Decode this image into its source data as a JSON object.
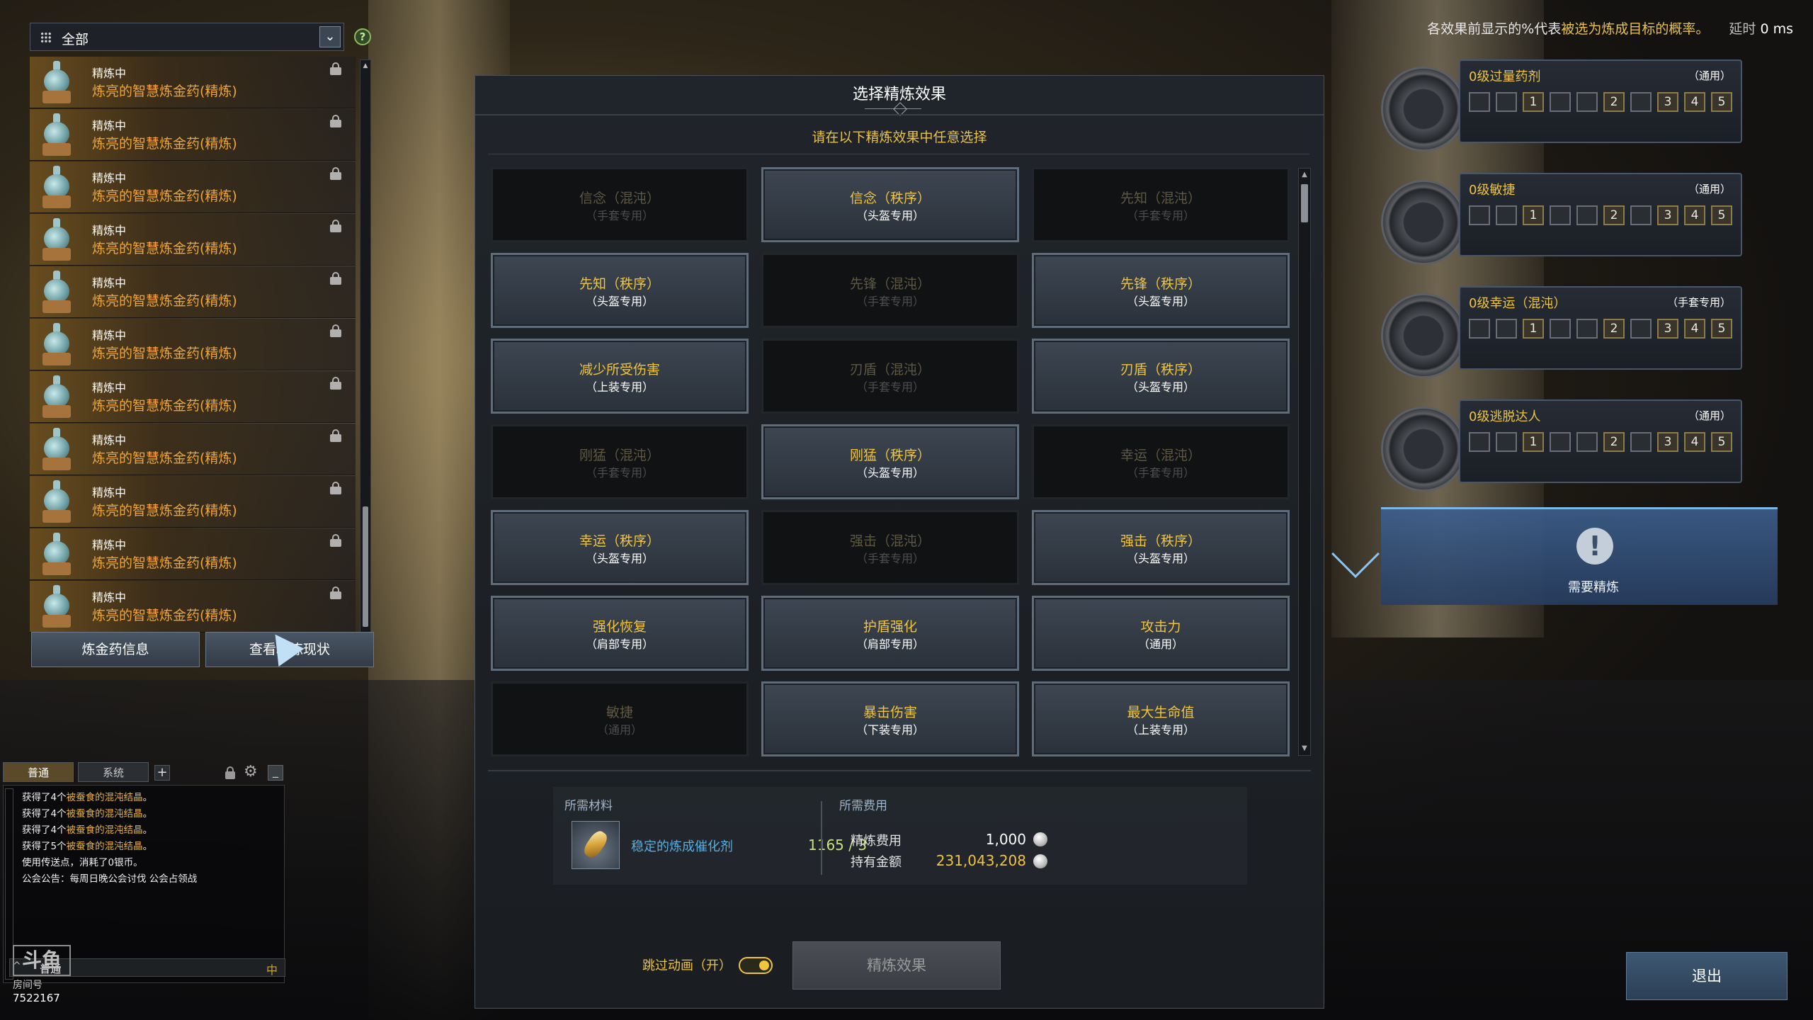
{
  "top_info": {
    "prefix": "各效果前显示的%代表",
    "highlight": "被选为炼成目标的概率。",
    "latency_label": "延时",
    "latency_value": "0 ms"
  },
  "left_panel": {
    "filter_value": "全部",
    "dropdown_icon": "chevron-down-icon",
    "help_label": "?",
    "items": [
      {
        "state": "精炼中",
        "name": "炼亮的智慧炼金药(精炼)"
      },
      {
        "state": "精炼中",
        "name": "炼亮的智慧炼金药(精炼)"
      },
      {
        "state": "精炼中",
        "name": "炼亮的智慧炼金药(精炼)"
      },
      {
        "state": "精炼中",
        "name": "炼亮的智慧炼金药(精炼)"
      },
      {
        "state": "精炼中",
        "name": "炼亮的智慧炼金药(精炼)"
      },
      {
        "state": "精炼中",
        "name": "炼亮的智慧炼金药(精炼)"
      },
      {
        "state": "精炼中",
        "name": "炼亮的智慧炼金药(精炼)"
      },
      {
        "state": "精炼中",
        "name": "炼亮的智慧炼金药(精炼)"
      },
      {
        "state": "精炼中",
        "name": "炼亮的智慧炼金药(精炼)"
      },
      {
        "state": "精炼中",
        "name": "炼亮的智慧炼金药(精炼)"
      },
      {
        "state": "精炼中",
        "name": "炼亮的智慧炼金药(精炼)"
      }
    ],
    "btn_info": "炼金药信息",
    "btn_status": "查看精炼现状"
  },
  "chat": {
    "tab_normal": "普通",
    "tab_system": "系统",
    "plus": "+",
    "lines": [
      {
        "pre": "获得了4个",
        "item": "被蚕食的混沌结晶",
        "post": "。"
      },
      {
        "pre": "获得了4个",
        "item": "被蚕食的混沌结晶",
        "post": "。"
      },
      {
        "pre": "获得了4个",
        "item": "被蚕食的混沌结晶",
        "post": "。"
      },
      {
        "pre": "获得了5个",
        "item": "被蚕食的混沌结晶",
        "post": "。"
      },
      {
        "pre": "使用传送点，消耗了0银币。",
        "item": "",
        "post": ""
      },
      {
        "pre": "公会公告：每周日晚公会讨伐 公会占领战",
        "item": "",
        "post": ""
      }
    ],
    "input_channel": "普通",
    "watermark_logo": "斗鱼",
    "watermark_room": "房间号",
    "watermark_id": "7522167"
  },
  "dialog": {
    "title": "选择精炼效果",
    "subtitle": "请在以下精炼效果中任意选择",
    "effects": [
      {
        "name": "信念（混沌）",
        "sub": "（手套专用）",
        "enabled": false
      },
      {
        "name": "信念（秩序）",
        "sub": "（头盔专用）",
        "enabled": true
      },
      {
        "name": "先知（混沌）",
        "sub": "（手套专用）",
        "enabled": false
      },
      {
        "name": "先知（秩序）",
        "sub": "（头盔专用）",
        "enabled": true
      },
      {
        "name": "先锋（混沌）",
        "sub": "（手套专用）",
        "enabled": false
      },
      {
        "name": "先锋（秩序）",
        "sub": "（头盔专用）",
        "enabled": true
      },
      {
        "name": "减少所受伤害",
        "sub": "（上装专用）",
        "enabled": true
      },
      {
        "name": "刃盾（混沌）",
        "sub": "（手套专用）",
        "enabled": false
      },
      {
        "name": "刃盾（秩序）",
        "sub": "（头盔专用）",
        "enabled": true
      },
      {
        "name": "刚猛（混沌）",
        "sub": "（手套专用）",
        "enabled": false
      },
      {
        "name": "刚猛（秩序）",
        "sub": "（头盔专用）",
        "enabled": true
      },
      {
        "name": "幸运（混沌）",
        "sub": "（手套专用）",
        "enabled": false
      },
      {
        "name": "幸运（秩序）",
        "sub": "（头盔专用）",
        "enabled": true
      },
      {
        "name": "强击（混沌）",
        "sub": "（手套专用）",
        "enabled": false
      },
      {
        "name": "强击（秩序）",
        "sub": "（头盔专用）",
        "enabled": true
      },
      {
        "name": "强化恢复",
        "sub": "（肩部专用）",
        "enabled": true
      },
      {
        "name": "护盾强化",
        "sub": "（肩部专用）",
        "enabled": true
      },
      {
        "name": "攻击力",
        "sub": "（通用）",
        "enabled": true
      },
      {
        "name": "敏捷",
        "sub": "（通用）",
        "enabled": false
      },
      {
        "name": "暴击伤害",
        "sub": "（下装专用）",
        "enabled": true
      },
      {
        "name": "最大生命值",
        "sub": "（上装专用）",
        "enabled": true
      }
    ],
    "materials_label": "所需材料",
    "material_name": "稳定的炼成催化剂",
    "material_count": "1165 / 3",
    "cost_label": "所需费用",
    "refine_fee_label": "精炼费用",
    "refine_fee_value": "1,000",
    "owned_label": "持有金额",
    "owned_value": "231,043,208",
    "skip_anim_label": "跳过动画（开）",
    "skip_anim_on": true,
    "refine_button": "精炼效果"
  },
  "right_panel": {
    "slots": [
      {
        "title": "0级过量药剂",
        "tag": "（通用）",
        "levels": [
          "1",
          "2",
          "3",
          "4",
          "5"
        ]
      },
      {
        "title": "0级敏捷",
        "tag": "（通用）",
        "levels": [
          "1",
          "2",
          "3",
          "4",
          "5"
        ]
      },
      {
        "title": "0级幸运（混沌）",
        "tag": "（手套专用）",
        "levels": [
          "1",
          "2",
          "3",
          "4",
          "5"
        ]
      },
      {
        "title": "0级逃脱达人",
        "tag": "（通用）",
        "levels": [
          "1",
          "2",
          "3",
          "4",
          "5"
        ]
      }
    ],
    "need_icon": "!",
    "need_text": "需要精炼",
    "exit_button": "退出"
  }
}
